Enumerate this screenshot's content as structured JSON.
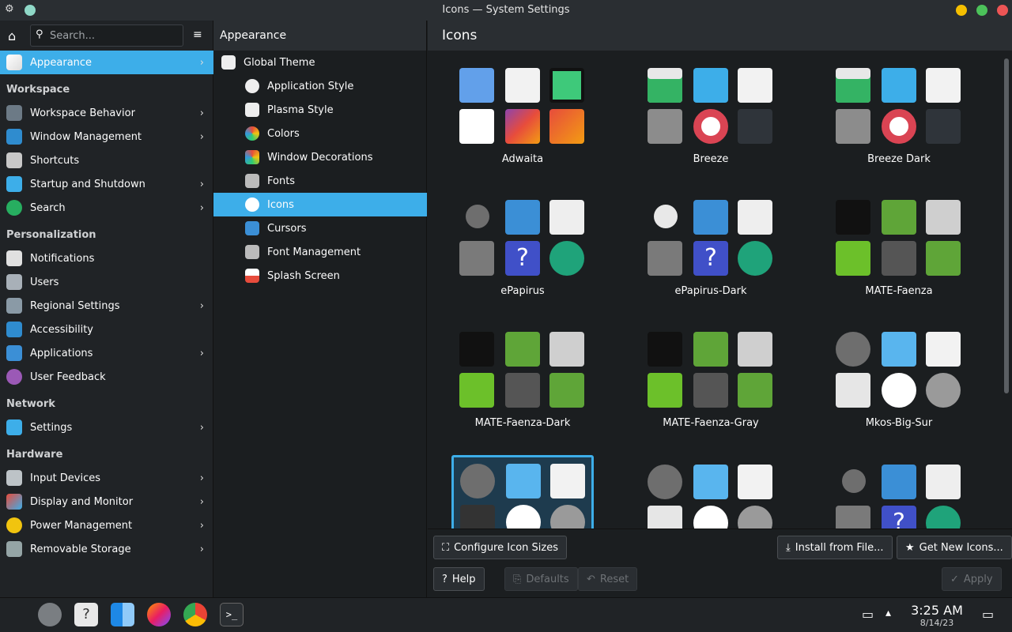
{
  "window": {
    "title": "Icons — System Settings"
  },
  "search": {
    "placeholder": "Search..."
  },
  "sidebar": {
    "appearance": "Appearance",
    "sections": [
      "Workspace",
      "Personalization",
      "Network",
      "Hardware"
    ],
    "workspace": [
      "Workspace Behavior",
      "Window Management",
      "Shortcuts",
      "Startup and Shutdown",
      "Search"
    ],
    "personalization": [
      "Notifications",
      "Users",
      "Regional Settings",
      "Accessibility",
      "Applications",
      "User Feedback"
    ],
    "network": [
      "Settings"
    ],
    "hardware": [
      "Input Devices",
      "Display and Monitor",
      "Power Management",
      "Removable Storage"
    ]
  },
  "subpanel": {
    "title": "Appearance",
    "items": [
      "Global Theme",
      "Application Style",
      "Plasma Style",
      "Colors",
      "Window Decorations",
      "Fonts",
      "Icons",
      "Cursors",
      "Font Management",
      "Splash Screen"
    ]
  },
  "main": {
    "title": "Icons",
    "themes": [
      "Adwaita",
      "Breeze",
      "Breeze Dark",
      "ePapirus",
      "ePapirus-Dark",
      "MATE-Faenza",
      "MATE-Faenza-Dark",
      "MATE-Faenza-Gray",
      "Mkos-Big-Sur"
    ],
    "buttons": {
      "configure": "Configure Icon Sizes",
      "install": "Install from File...",
      "get_new": "Get New Icons...",
      "help": "Help",
      "defaults": "Defaults",
      "reset": "Reset",
      "apply": "Apply"
    }
  },
  "taskbar": {
    "time": "3:25 AM",
    "date": "8/14/23"
  },
  "colors": {
    "accent": "#3daee9",
    "close": "#ed5555",
    "minimize": "#f5bf00",
    "maximize": "#4cc25a"
  }
}
